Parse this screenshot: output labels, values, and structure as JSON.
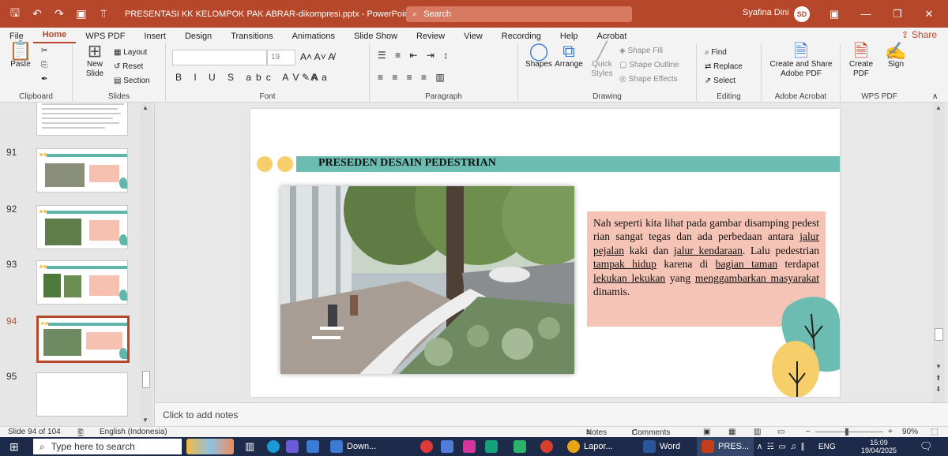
{
  "titlebar": {
    "doc_title": "PRESENTASI KK KELOMPOK PAK ABRAR-dikompresi.pptx  -  PowerPoint",
    "search_placeholder": "Search",
    "user_name": "Syafina Dini",
    "user_initials": "SD"
  },
  "tabs": [
    "File",
    "Home",
    "WPS PDF",
    "Insert",
    "Design",
    "Transitions",
    "Animations",
    "Slide Show",
    "Review",
    "View",
    "Recording",
    "Help",
    "Acrobat"
  ],
  "active_tab": "Home",
  "share_label": "Share",
  "ribbon": {
    "clipboard": {
      "label": "Clipboard",
      "paste": "Paste"
    },
    "slides": {
      "label": "Slides",
      "new_slide_l1": "New",
      "new_slide_l2": "Slide",
      "layout": "Layout",
      "reset": "Reset",
      "section": "Section"
    },
    "font": {
      "label": "Font",
      "size": "19"
    },
    "paragraph": {
      "label": "Paragraph"
    },
    "drawing": {
      "label": "Drawing",
      "shapes": "Shapes",
      "arrange": "Arrange",
      "quick_styles_l1": "Quick",
      "quick_styles_l2": "Styles",
      "shape_fill": "Shape Fill",
      "shape_outline": "Shape Outline",
      "shape_effects": "Shape Effects"
    },
    "editing": {
      "label": "Editing",
      "find": "Find",
      "replace": "Replace",
      "select": "Select"
    },
    "acrobat": {
      "label": "Adobe Acrobat",
      "create_share_l1": "Create and Share",
      "create_share_l2": "Adobe PDF"
    },
    "wpspdf": {
      "label": "WPS PDF",
      "create_pdf_l1": "Create",
      "create_pdf_l2": "PDF",
      "sign": "Sign"
    }
  },
  "thumbnails": [
    {
      "number": "91"
    },
    {
      "number": "92"
    },
    {
      "number": "93"
    },
    {
      "number": "94"
    },
    {
      "number": "95"
    }
  ],
  "active_slide": "94",
  "slide": {
    "title": "PRESEDEN DESAIN PEDESTRIAN",
    "body_parts": [
      {
        "text": "Nah seperti kita lihat pada gambar disamping pedest rian sangat tegas dan ada perbedaan antara ",
        "underline": false
      },
      {
        "text": "jalur pejalan",
        "underline": true
      },
      {
        "text": " kaki dan ",
        "underline": false
      },
      {
        "text": "jalur kendaraan",
        "underline": true
      },
      {
        "text": ". Lalu pedestrian ",
        "underline": false
      },
      {
        "text": "tampak hidup",
        "underline": true
      },
      {
        "text": " karena di ",
        "underline": false
      },
      {
        "text": "bagian taman",
        "underline": true
      },
      {
        "text": " terdapat ",
        "underline": false
      },
      {
        "text": "lekukan lekukan",
        "underline": true
      },
      {
        "text": " yang ",
        "underline": false
      },
      {
        "text": "menggambarkan masyarakat",
        "underline": true
      },
      {
        "text": " dinamis.",
        "underline": false
      }
    ]
  },
  "notes_placeholder": "Click to add notes",
  "status": {
    "slide_info": "Slide 94 of 104",
    "language": "English (Indonesia)",
    "notes": "Notes",
    "comments": "Comments",
    "zoom": "90%"
  },
  "taskbar": {
    "search_placeholder": "Type here to search",
    "apps": [
      {
        "label": "Down...",
        "icon": "download-icon",
        "color": "#3a7bd5"
      },
      {
        "label": "Lapor...",
        "icon": "chrome-icon",
        "color": "#e8a317"
      },
      {
        "label": "Word",
        "icon": "word-icon",
        "color": "#2b579a"
      },
      {
        "label": "PRES...",
        "icon": "powerpoint-icon",
        "color": "#c43e1c"
      }
    ],
    "lang": "ENG",
    "time": "15:09",
    "date": "19/04/2025"
  },
  "colors": {
    "accent": "#b7472a",
    "teal": "#6cbcb1",
    "salmon": "#f6c4b6",
    "yellow": "#f7cf6a"
  }
}
